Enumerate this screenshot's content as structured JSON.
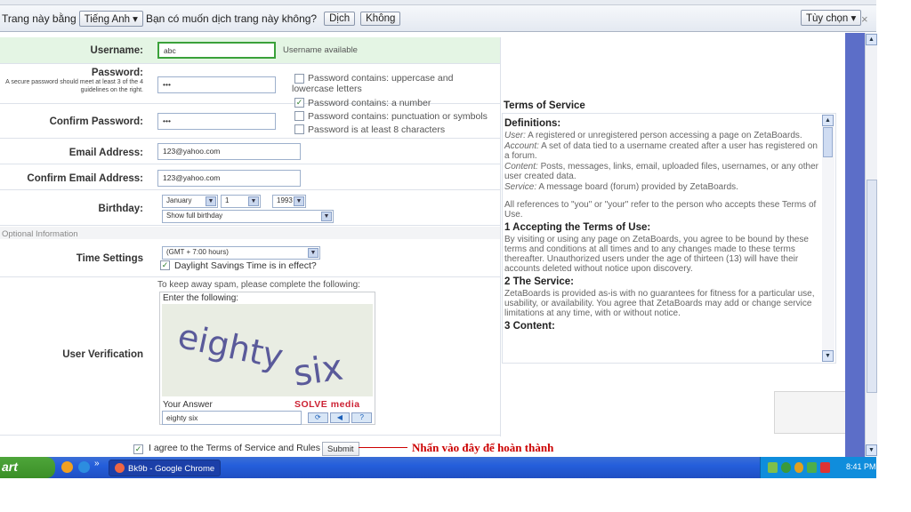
{
  "translate_bar": {
    "prefix": "Trang này bằng",
    "language": "Tiếng Anh ▾",
    "question": "Bạn có muốn dịch trang này không?",
    "translate_button": "Dịch",
    "no_button": "Không",
    "options_button": "Tùy chọn ▾",
    "close": "×"
  },
  "form": {
    "username": {
      "label": "Username:",
      "value": "abc",
      "status": "Username available"
    },
    "password": {
      "label": "Password:",
      "hint": "A secure password should meet at least 3 of the 4 guidelines on the right.",
      "value": "•••",
      "rules": [
        {
          "text": "Password contains: uppercase and lowercase letters",
          "checked": false
        },
        {
          "text": "Password contains: a number",
          "checked": true
        },
        {
          "text": "Password contains: punctuation or symbols",
          "checked": false
        },
        {
          "text": "Password is at least 8 characters",
          "checked": false
        }
      ]
    },
    "confirm_password": {
      "label": "Confirm Password:",
      "value": "•••"
    },
    "email": {
      "label": "Email Address:",
      "value": "123@yahoo.com"
    },
    "confirm_email": {
      "label": "Confirm Email Address:",
      "value": "123@yahoo.com"
    },
    "birthday": {
      "label": "Birthday:",
      "month": "January",
      "day": "1",
      "year": "1993",
      "display": "Show full birthday"
    },
    "optional_header": "Optional Information",
    "time_settings": {
      "label": "Time Settings",
      "timezone": "(GMT + 7:00 hours)",
      "dst": "Daylight Savings Time is in effect?"
    },
    "verification": {
      "label": "User Verification",
      "instruction": "To keep away spam, please complete the following:",
      "prompt": "Enter the following:",
      "captcha_word1": "eighty",
      "captcha_word2": "six",
      "answer_label": "Your Answer",
      "brand": "SOLVE media",
      "answer": "eighty six"
    },
    "agree": "I agree to the Terms of Service and Rules",
    "submit": "Submit"
  },
  "terms": {
    "title": "Terms of Service",
    "definitions_heading": "Definitions:",
    "definitions": [
      {
        "term": "User:",
        "text": "A registered or unregistered person accessing a page on ZetaBoards."
      },
      {
        "term": "Account:",
        "text": "A set of data tied to a username created after a user has registered on a forum."
      },
      {
        "term": "Content:",
        "text": "Posts, messages, links, email, uploaded files, usernames, or any other user created data."
      },
      {
        "term": "Service:",
        "text": "A message board (forum) provided by ZetaBoards."
      }
    ],
    "references": "All references to \"you\" or \"your\" refer to the person who accepts these Terms of Use.",
    "s1_heading": "1 Accepting the Terms of Use:",
    "s1_text": "By visiting or using any page on ZetaBoards, you agree to be bound by these terms and conditions at all times and to any changes made to these terms thereafter. Unauthorized users under the age of thirteen (13) will have their accounts deleted without notice upon discovery.",
    "s2_heading": "2 The Service:",
    "s2_text": "ZetaBoards is provided as-is with no guarantees for fitness for a particular use, usability, or availability. You agree that ZetaBoards may add or change service limitations at any time, with or without notice.",
    "s3_heading": "3 Content:"
  },
  "annotation": "Nhấn vào đây để hoàn thành",
  "taskbar": {
    "start": "art",
    "task": "Bk9b - Google Chrome",
    "clock": "8:41 PM"
  }
}
